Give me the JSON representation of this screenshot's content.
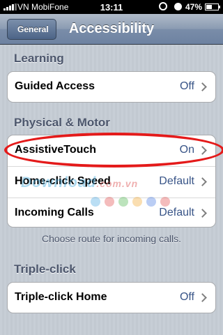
{
  "status_bar": {
    "carrier": "VN MobiFone",
    "time": "13:11",
    "battery_percent": "47%"
  },
  "nav": {
    "back_label": "General",
    "title": "Accessibility"
  },
  "sections": {
    "learning": {
      "header": "Learning",
      "rows": [
        {
          "label": "Guided Access",
          "value": "Off"
        }
      ]
    },
    "physical_motor": {
      "header": "Physical & Motor",
      "rows": [
        {
          "label": "AssistiveTouch",
          "value": "On"
        },
        {
          "label": "Home-click Speed",
          "value": "Default"
        },
        {
          "label": "Incoming Calls",
          "value": "Default"
        }
      ],
      "footer": "Choose route for incoming calls."
    },
    "triple_click": {
      "header": "Triple-click",
      "rows": [
        {
          "label": "Triple-click Home",
          "value": "Off"
        }
      ]
    }
  },
  "watermark": {
    "text": "Download",
    "suffix": ".com.vn"
  },
  "colors": {
    "highlight": "#e41a1a",
    "value_text": "#385487",
    "section_header": "#4c566c"
  }
}
